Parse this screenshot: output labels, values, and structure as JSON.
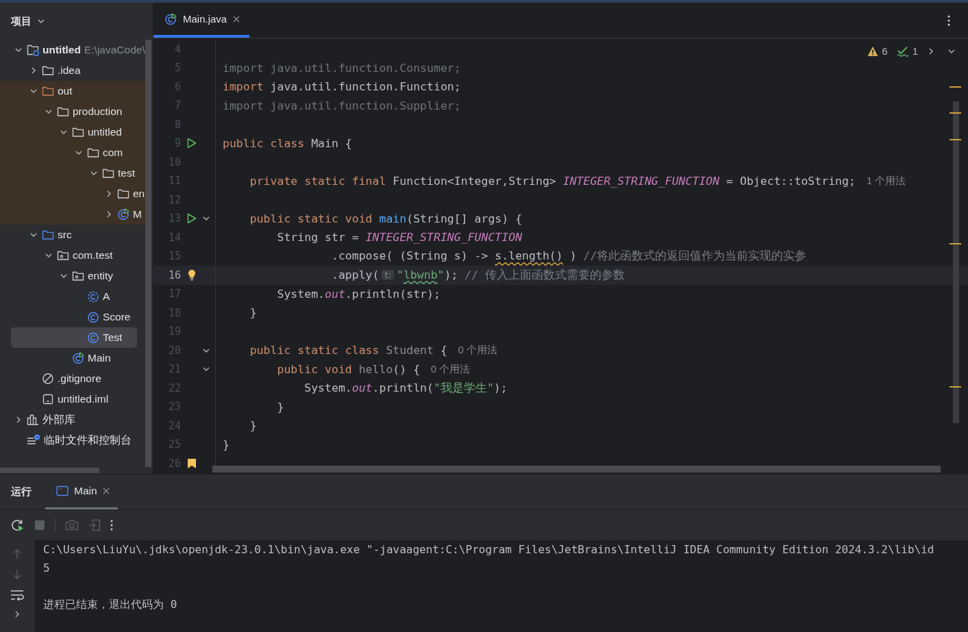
{
  "project_panel": {
    "title": "项目",
    "tree": [
      {
        "label": "untitled",
        "kind": "project",
        "hint": "E:\\javaCode\\",
        "expanded": true,
        "selected": false,
        "children": [
          {
            "label": ".idea",
            "kind": "folder",
            "expanded": false,
            "selected": false
          },
          {
            "label": "out",
            "kind": "excluded",
            "expanded": true,
            "selected": false,
            "children": [
              {
                "label": "production",
                "kind": "folder",
                "expanded": true,
                "selected": false,
                "children": [
                  {
                    "label": "untitled",
                    "kind": "folder",
                    "expanded": true,
                    "selected": false,
                    "children": [
                      {
                        "label": "com",
                        "kind": "folder",
                        "expanded": true,
                        "selected": false,
                        "children": [
                          {
                            "label": "test",
                            "kind": "folder",
                            "expanded": true,
                            "selected": false,
                            "children": [
                              {
                                "label": "en",
                                "kind": "folder",
                                "expanded": false,
                                "selected": false
                              },
                              {
                                "label": "M",
                                "kind": "main",
                                "expanded": false,
                                "selected": false
                              }
                            ]
                          }
                        ]
                      }
                    ]
                  }
                ]
              }
            ]
          },
          {
            "label": "src",
            "kind": "source",
            "expanded": true,
            "selected": false,
            "children": [
              {
                "label": "com.test",
                "kind": "package",
                "expanded": true,
                "selected": false,
                "children": [
                  {
                    "label": "entity",
                    "kind": "package",
                    "expanded": true,
                    "selected": false,
                    "children": [
                      {
                        "label": "A",
                        "kind": "abstract_class",
                        "selected": false
                      },
                      {
                        "label": "Score",
                        "kind": "class",
                        "selected": false
                      },
                      {
                        "label": "Test",
                        "kind": "class",
                        "selected": true
                      }
                    ]
                  },
                  {
                    "label": "Main",
                    "kind": "main",
                    "selected": false
                  }
                ]
              }
            ]
          },
          {
            "label": ".gitignore",
            "kind": "gitignore",
            "selected": false
          },
          {
            "label": "untitled.iml",
            "kind": "iml",
            "selected": false
          }
        ]
      },
      {
        "label": "外部库",
        "kind": "library",
        "expanded": false,
        "selected": false
      },
      {
        "label": "临时文件和控制台",
        "kind": "scratch",
        "selected": false
      }
    ]
  },
  "editor": {
    "tabs": [
      {
        "label": "Main.java",
        "selected": true
      }
    ],
    "inspections": {
      "warnings": "6",
      "weak_warnings": "1"
    },
    "lines": [
      {
        "number": "4",
        "current": false
      },
      {
        "number": "5",
        "current": false,
        "tokens": [
          {
            "text": "import java.util.function.Consumer;",
            "kind": "unused"
          }
        ]
      },
      {
        "number": "6",
        "current": false,
        "tokens": [
          {
            "text": "import",
            "kind": "keyword"
          },
          {
            "text": " java.util.function.Function;",
            "kind": "plain"
          }
        ]
      },
      {
        "number": "7",
        "current": false,
        "tokens": [
          {
            "text": "import java.util.function.Supplier;",
            "kind": "unused"
          }
        ]
      },
      {
        "number": "8",
        "current": false
      },
      {
        "number": "9",
        "current": false,
        "markers": [
          {
            "kind": "run"
          }
        ],
        "tokens": [
          {
            "text": "public class",
            "kind": "keyword"
          },
          {
            "text": " Main {",
            "kind": "plain"
          }
        ]
      },
      {
        "number": "10",
        "current": false
      },
      {
        "number": "11",
        "current": false,
        "tokens": [
          {
            "text": "    private static final",
            "kind": "keyword"
          },
          {
            "text": " Function<Integer,String> ",
            "kind": "plain"
          },
          {
            "text": "INTEGER_STRING_FUNCTION",
            "kind": "constant"
          },
          {
            "text": " = Object::toString;",
            "kind": "plain"
          },
          {
            "text": "1 个用法",
            "kind": "usage"
          }
        ]
      },
      {
        "number": "12",
        "current": false
      },
      {
        "number": "13",
        "current": false,
        "markers": [
          {
            "kind": "run"
          },
          {
            "kind": "fold"
          }
        ],
        "tokens": [
          {
            "text": "    public static void ",
            "kind": "keyword"
          },
          {
            "text": "main",
            "kind": "method"
          },
          {
            "text": "(String[] args) {",
            "kind": "plain"
          }
        ]
      },
      {
        "number": "14",
        "current": false,
        "tokens": [
          {
            "text": "        String str = ",
            "kind": "plain"
          },
          {
            "text": "INTEGER_STRING_FUNCTION",
            "kind": "constant"
          }
        ]
      },
      {
        "number": "15",
        "current": false,
        "tokens": [
          {
            "text": "                .compose( (String s) -> ",
            "kind": "plain"
          },
          {
            "text": "s.length()",
            "kind": "warning"
          },
          {
            "text": " ) ",
            "kind": "plain"
          },
          {
            "text": "//将此函数式的返回值作为当前实现的实参",
            "kind": "comment"
          }
        ]
      },
      {
        "number": "16",
        "current": true,
        "markers": [
          {
            "kind": "bulb"
          }
        ],
        "tokens": [
          {
            "text": "                .apply(",
            "kind": "plain"
          },
          {
            "text": "t:",
            "kind": "parameter"
          },
          {
            "text": "\"",
            "kind": "string"
          },
          {
            "text": "lbwnb",
            "kind": "typo"
          },
          {
            "text": "\"",
            "kind": "string"
          },
          {
            "text": "); ",
            "kind": "plain"
          },
          {
            "text": "// 传入上面函数式需要的参数",
            "kind": "comment"
          }
        ]
      },
      {
        "number": "17",
        "current": false,
        "tokens": [
          {
            "text": "        System.",
            "kind": "plain"
          },
          {
            "text": "out",
            "kind": "static"
          },
          {
            "text": ".println(str);",
            "kind": "plain"
          }
        ]
      },
      {
        "number": "18",
        "current": false,
        "tokens": [
          {
            "text": "    }",
            "kind": "plain"
          }
        ]
      },
      {
        "number": "19",
        "current": false
      },
      {
        "number": "20",
        "current": false,
        "markers": [
          {
            "kind": "fold"
          }
        ],
        "tokens": [
          {
            "text": "    public static class ",
            "kind": "keyword"
          },
          {
            "text": "Student",
            "kind": "grey"
          },
          {
            "text": " {",
            "kind": "plain"
          },
          {
            "text": "0 个用法",
            "kind": "usage"
          }
        ]
      },
      {
        "number": "21",
        "current": false,
        "markers": [
          {
            "kind": "fold"
          }
        ],
        "tokens": [
          {
            "text": "        public void ",
            "kind": "keyword"
          },
          {
            "text": "hello",
            "kind": "grey"
          },
          {
            "text": "() {",
            "kind": "plain"
          },
          {
            "text": "0 个用法",
            "kind": "usage"
          }
        ]
      },
      {
        "number": "22",
        "current": false,
        "tokens": [
          {
            "text": "            System.",
            "kind": "plain"
          },
          {
            "text": "out",
            "kind": "static"
          },
          {
            "text": ".println(",
            "kind": "plain"
          },
          {
            "text": "\"我是学生\"",
            "kind": "string"
          },
          {
            "text": ");",
            "kind": "plain"
          }
        ]
      },
      {
        "number": "23",
        "current": false,
        "tokens": [
          {
            "text": "        }",
            "kind": "plain"
          }
        ]
      },
      {
        "number": "24",
        "current": false,
        "tokens": [
          {
            "text": "    }",
            "kind": "plain"
          }
        ]
      },
      {
        "number": "25",
        "current": false,
        "tokens": [
          {
            "text": "}",
            "kind": "plain"
          }
        ]
      },
      {
        "number": "26",
        "current": false,
        "markers": [
          {
            "kind": "bookmark"
          }
        ]
      }
    ]
  },
  "run_panel": {
    "title": "运行",
    "tabs": [
      {
        "label": "Main",
        "selected": true
      }
    ],
    "console": [
      {
        "text": "C:\\Users\\LiuYu\\.jdks\\openjdk-23.0.1\\bin\\java.exe \"-javaagent:C:\\Program Files\\JetBrains\\IntelliJ IDEA Community Edition 2024.3.2\\lib\\id",
        "kind": "command"
      },
      {
        "text": "5",
        "kind": "output"
      },
      {
        "text": "进程已结束，退出代码为 0",
        "kind": "status"
      }
    ]
  }
}
